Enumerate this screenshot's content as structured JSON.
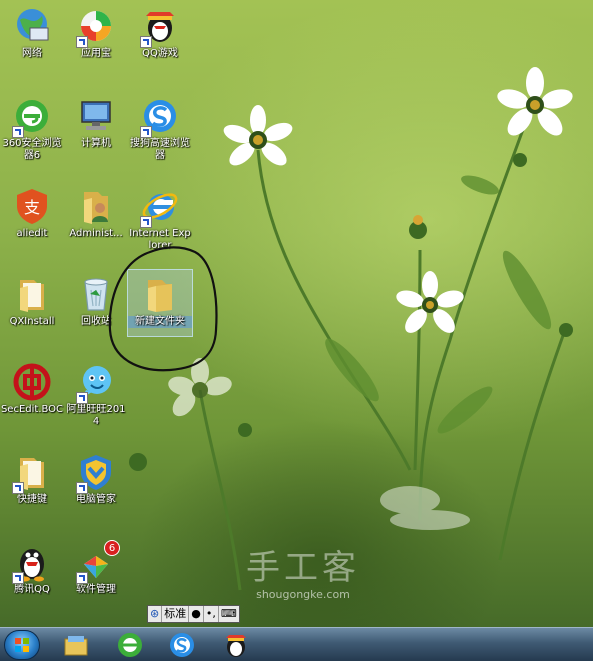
{
  "desktop": {
    "icons": [
      {
        "label": "网络"
      },
      {
        "label": "应用宝"
      },
      {
        "label": "QQ游戏"
      },
      {
        "label": "360安全浏览器6"
      },
      {
        "label": "计算机"
      },
      {
        "label": "搜狗高速浏览器"
      },
      {
        "label": "aliedit"
      },
      {
        "label": "Administ..."
      },
      {
        "label": "Internet Explorer"
      },
      {
        "label": "QXInstall"
      },
      {
        "label": "回收站"
      },
      {
        "label": "新建文件夹"
      },
      {
        "label": "SecEdit.BOC"
      },
      {
        "label": "阿里旺旺2014"
      },
      {
        "label": "快捷键"
      },
      {
        "label": "电脑管家"
      },
      {
        "label": "腾讯QQ"
      },
      {
        "label": "软件管理"
      }
    ],
    "badge": "6"
  },
  "watermark": {
    "main": "手工客",
    "sub": "shougongke.com"
  },
  "ime": {
    "mode": "标准",
    "dot": "●",
    "punct": "•,"
  },
  "colors": {
    "annotation": "#111111",
    "selection": "#5a96dc",
    "taskbar": "#253a4f"
  }
}
